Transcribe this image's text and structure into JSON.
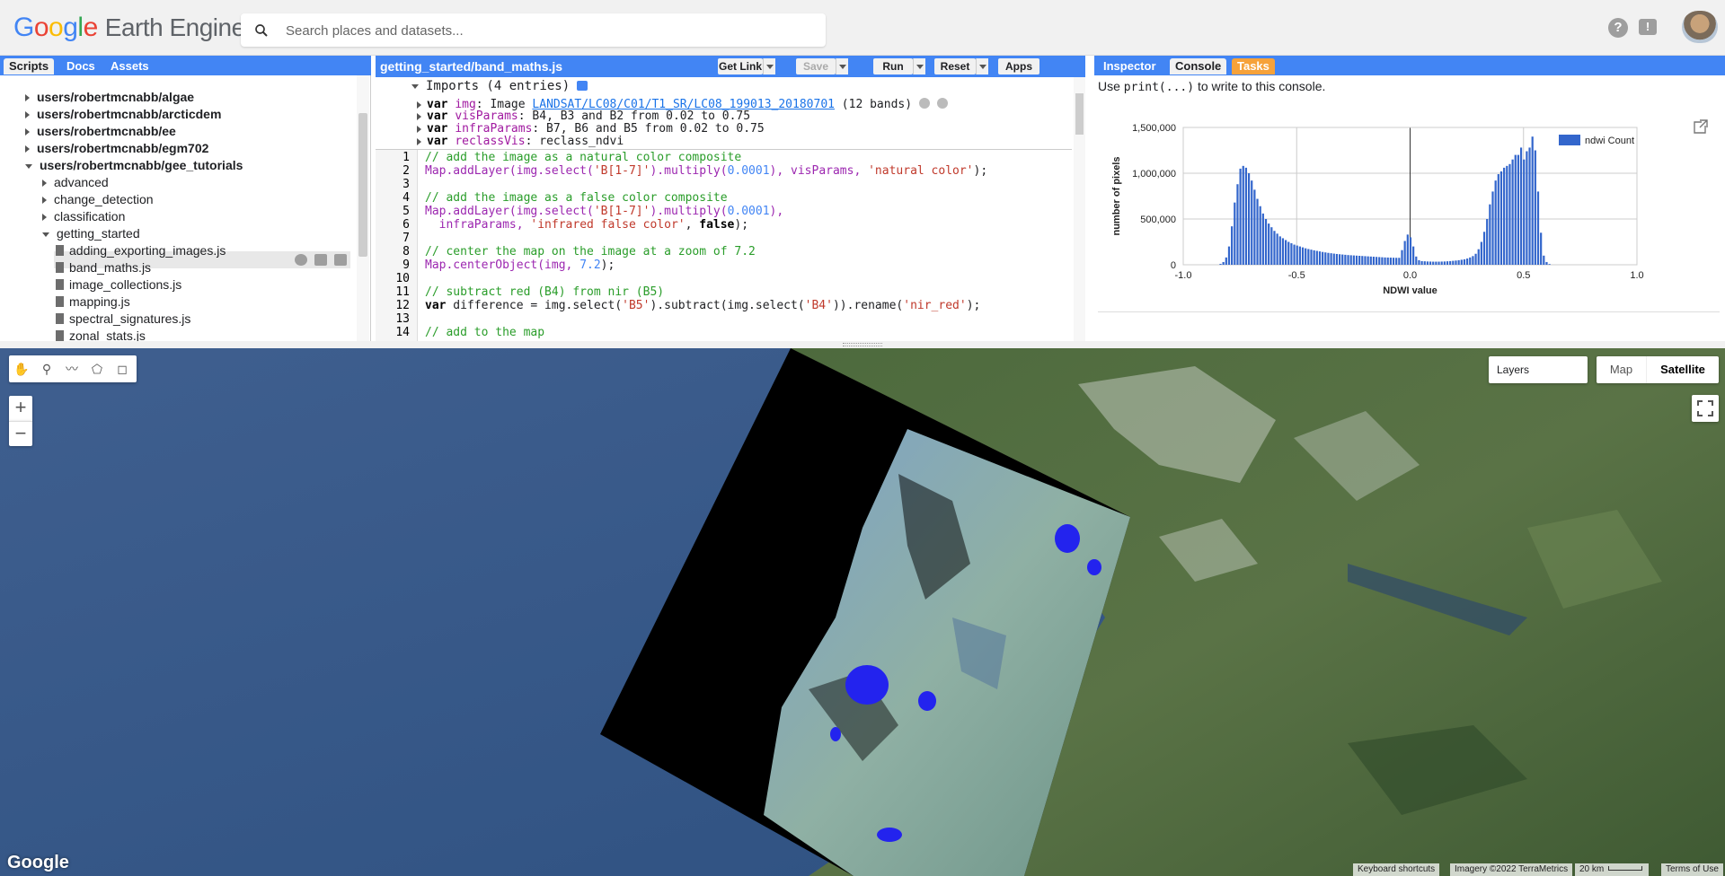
{
  "header": {
    "logo_google": "Google",
    "logo_product": "Earth Engine",
    "search_placeholder": "Search places and datasets..."
  },
  "left_panel": {
    "tabs": [
      "Scripts",
      "Docs",
      "Assets"
    ],
    "tree": [
      {
        "label": "users/robertmcnabb/algae",
        "level": 0,
        "kind": "repo"
      },
      {
        "label": "users/robertmcnabb/arcticdem",
        "level": 0,
        "kind": "repo"
      },
      {
        "label": "users/robertmcnabb/ee",
        "level": 0,
        "kind": "repo"
      },
      {
        "label": "users/robertmcnabb/egm702",
        "level": 0,
        "kind": "repo"
      },
      {
        "label": "users/robertmcnabb/gee_tutorials",
        "level": 0,
        "kind": "repo-open"
      },
      {
        "label": "advanced",
        "level": 1,
        "kind": "folder"
      },
      {
        "label": "change_detection",
        "level": 1,
        "kind": "folder"
      },
      {
        "label": "classification",
        "level": 1,
        "kind": "folder"
      },
      {
        "label": "getting_started",
        "level": 1,
        "kind": "folder-open"
      },
      {
        "label": "adding_exporting_images.js",
        "level": 2,
        "kind": "file"
      },
      {
        "label": "band_maths.js",
        "level": 2,
        "kind": "file-selected"
      },
      {
        "label": "image_collections.js",
        "level": 2,
        "kind": "file"
      },
      {
        "label": "mapping.js",
        "level": 2,
        "kind": "file"
      },
      {
        "label": "spectral_signatures.js",
        "level": 2,
        "kind": "file"
      },
      {
        "label": "zonal_stats.js",
        "level": 2,
        "kind": "file"
      }
    ]
  },
  "editor": {
    "file_title": "getting_started/band_maths.js",
    "buttons": {
      "get_link": "Get Link",
      "save": "Save",
      "run": "Run",
      "reset": "Reset",
      "apps": "Apps"
    },
    "imports_header": "Imports (4 entries)",
    "imports": [
      {
        "kw": "var",
        "name": "img",
        "rest": ": Image ",
        "link": "LANDSAT/LC08/C01/T1_SR/LC08_199013_20180701",
        "tail": " (12 bands)"
      },
      {
        "kw": "var",
        "name": "visParams",
        "rest": ": B4, B3 and B2 from 0.02 to 0.75",
        "link": "",
        "tail": ""
      },
      {
        "kw": "var",
        "name": "infraParams",
        "rest": ": B7, B6 and B5 from 0.02 to 0.75",
        "link": "",
        "tail": ""
      },
      {
        "kw": "var",
        "name": "reclassVis",
        "rest": ": reclass_ndvi",
        "link": "",
        "tail": ""
      }
    ],
    "line_numbers": [
      "1",
      "2",
      "3",
      "4",
      "5",
      "6",
      "7",
      "8",
      "9",
      "10",
      "11",
      "12",
      "13",
      "14"
    ],
    "code": {
      "l1": "// add the image as a natural color composite",
      "l2a": "Map.addLayer(img.select(",
      "l2b": "'B[1-7]'",
      "l2c": ").multiply(",
      "l2d": "0.0001",
      "l2e": "), visParams, ",
      "l2f": "'natural color'",
      "l2g": ");",
      "l4": "// add the image as a false color composite",
      "l5a": "Map.addLayer(img.select(",
      "l5b": "'B[1-7]'",
      "l5c": ").multiply(",
      "l5d": "0.0001",
      "l5e": "),",
      "l6a": "  infraParams, ",
      "l6b": "'infrared false color'",
      "l6c": ", ",
      "l6d": "false",
      "l6e": ");",
      "l8": "// center the map on the image at a zoom of 7.2",
      "l9a": "Map.centerObject(img, ",
      "l9b": "7.2",
      "l9c": ");",
      "l11": "// subtract red (B4) from nir (B5)",
      "l12a": "var",
      "l12b": " difference = img.select(",
      "l12c": "'B5'",
      "l12d": ").subtract(img.select(",
      "l12e": "'B4'",
      "l12f": ")).rename(",
      "l12g": "'nir_red'",
      "l12h": ");",
      "l14": "// add to the map"
    }
  },
  "right_panel": {
    "tabs": [
      "Inspector",
      "Console",
      "Tasks"
    ],
    "hint_pre": "Use ",
    "hint_code": "print(...)",
    "hint_post": " to write to this console."
  },
  "chart_data": {
    "type": "bar",
    "legend": [
      "ndwi Count"
    ],
    "xlabel": "NDWI value",
    "ylabel": "number of pixels",
    "xlim": [
      -1.0,
      1.0
    ],
    "ylim": [
      0,
      1500000
    ],
    "x_ticks": [
      "-1.0",
      "-0.5",
      "0.0",
      "0.5",
      "1.0"
    ],
    "y_ticks": [
      "0",
      "500,000",
      "1,000,000",
      "1,500,000"
    ],
    "legend_position": "top-right",
    "bar_color": "#3366cc",
    "bin_start": -0.84,
    "bin_width": 0.0125,
    "values": [
      10000,
      30000,
      80000,
      200000,
      420000,
      680000,
      880000,
      1050000,
      1080000,
      1060000,
      1000000,
      920000,
      820000,
      720000,
      640000,
      560000,
      500000,
      450000,
      410000,
      370000,
      340000,
      310000,
      290000,
      270000,
      250000,
      235000,
      220000,
      210000,
      200000,
      190000,
      180000,
      172000,
      165000,
      158000,
      152000,
      146000,
      140000,
      135000,
      130000,
      126000,
      122000,
      118000,
      115000,
      112000,
      109000,
      106000,
      104000,
      102000,
      100000,
      98000,
      96000,
      94000,
      92000,
      90000,
      88000,
      86000,
      84000,
      82000,
      80000,
      79000,
      78000,
      77000,
      76000,
      76000,
      160000,
      260000,
      330000,
      300000,
      200000,
      90000,
      50000,
      40000,
      38000,
      36000,
      35000,
      34000,
      34000,
      34000,
      35000,
      36000,
      38000,
      40000,
      43000,
      46000,
      50000,
      55000,
      60000,
      68000,
      80000,
      95000,
      120000,
      170000,
      250000,
      360000,
      500000,
      660000,
      800000,
      920000,
      990000,
      1020000,
      1060000,
      1080000,
      1100000,
      1150000,
      1200000,
      1200000,
      1280000,
      1150000,
      1240000,
      1280000,
      1400000,
      1250000,
      800000,
      350000,
      100000,
      30000,
      8000
    ]
  },
  "map": {
    "tools": [
      "hand-tool",
      "point-tool",
      "line-tool",
      "polygon-tool",
      "rectangle-tool"
    ],
    "layers_label": "Layers",
    "maptype_map": "Map",
    "maptype_satellite": "Satellite",
    "google_mark": "Google",
    "attribution": [
      "Keyboard shortcuts",
      "Imagery ©2022 TerraMetrics",
      "20 km",
      "Terms of Use"
    ]
  }
}
